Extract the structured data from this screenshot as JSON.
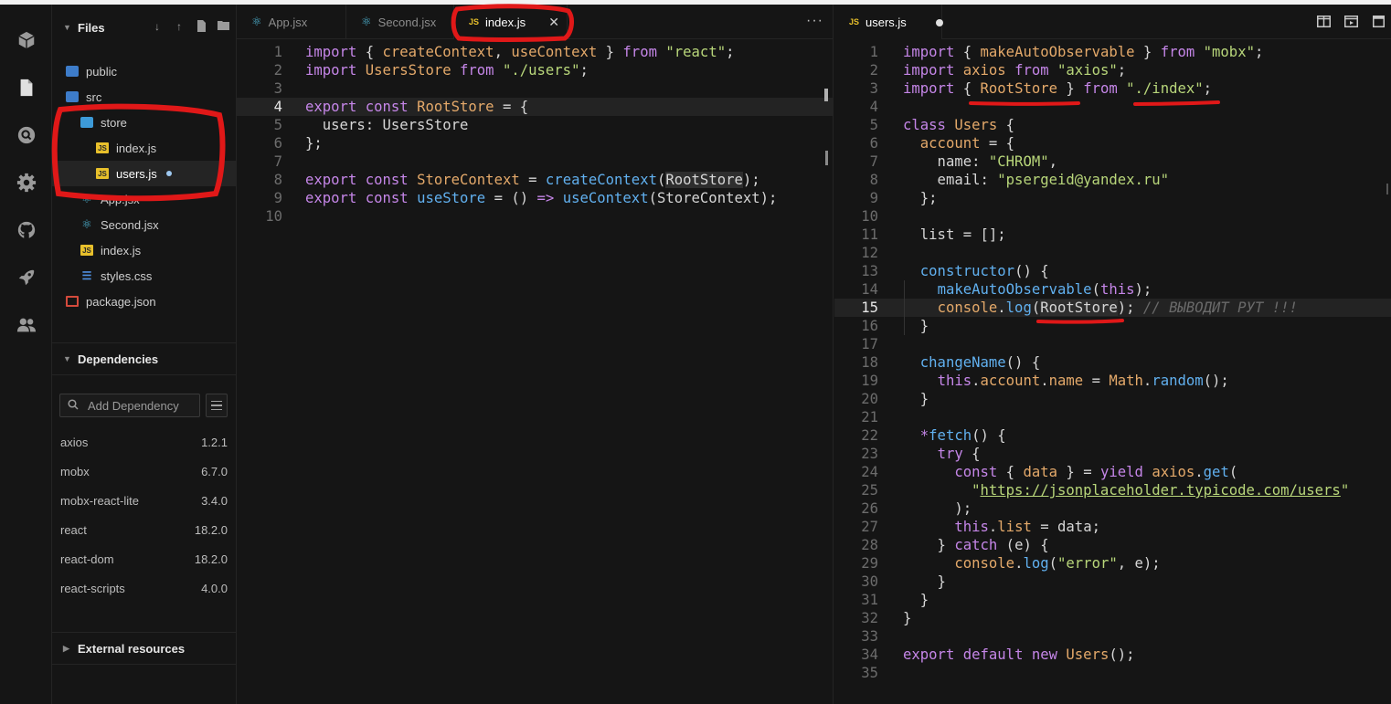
{
  "activity_bar": {
    "icons": [
      "cube-icon",
      "file-icon",
      "search-icon",
      "gear-icon",
      "github-icon",
      "rocket-icon",
      "users-icon"
    ]
  },
  "sidebar": {
    "files_title": "Files",
    "tree": [
      {
        "label": "public",
        "type": "folder"
      },
      {
        "label": "src",
        "type": "folder"
      },
      {
        "label": "store",
        "type": "folder"
      },
      {
        "label": "index.js",
        "type": "js"
      },
      {
        "label": "users.js",
        "type": "js",
        "modified": true,
        "active": true
      },
      {
        "label": "App.jsx",
        "type": "react"
      },
      {
        "label": "Second.jsx",
        "type": "react"
      },
      {
        "label": "index.js",
        "type": "js"
      },
      {
        "label": "styles.css",
        "type": "css"
      },
      {
        "label": "package.json",
        "type": "package"
      }
    ],
    "dependencies_title": "Dependencies",
    "add_dependency_placeholder": "Add Dependency",
    "dependencies": [
      {
        "name": "axios",
        "version": "1.2.1"
      },
      {
        "name": "mobx",
        "version": "6.7.0"
      },
      {
        "name": "mobx-react-lite",
        "version": "3.4.0"
      },
      {
        "name": "react",
        "version": "18.2.0"
      },
      {
        "name": "react-dom",
        "version": "18.2.0"
      },
      {
        "name": "react-scripts",
        "version": "4.0.0"
      }
    ],
    "external_resources_title": "External resources"
  },
  "left_editor": {
    "tabs": [
      {
        "label": "App.jsx",
        "icon": "react-icon"
      },
      {
        "label": "Second.jsx",
        "icon": "react-icon"
      },
      {
        "label": "index.js",
        "icon": "js-icon",
        "active": true
      }
    ],
    "more": "···",
    "line_numbers": [
      "1",
      "2",
      "3",
      "4",
      "5",
      "6",
      "7",
      "8",
      "9",
      "10"
    ],
    "current_line": "4"
  },
  "right_editor": {
    "tabs": [
      {
        "label": "users.js",
        "icon": "js-icon",
        "active": true,
        "modified": true
      }
    ],
    "line_numbers": [
      "1",
      "2",
      "3",
      "4",
      "5",
      "6",
      "7",
      "8",
      "9",
      "10",
      "11",
      "12",
      "13",
      "14",
      "15",
      "16",
      "17",
      "18",
      "19",
      "20",
      "21",
      "22",
      "23",
      "24",
      "25",
      "26",
      "27",
      "28",
      "29",
      "30",
      "31",
      "32",
      "33",
      "34",
      "35"
    ],
    "current_line": "15"
  }
}
